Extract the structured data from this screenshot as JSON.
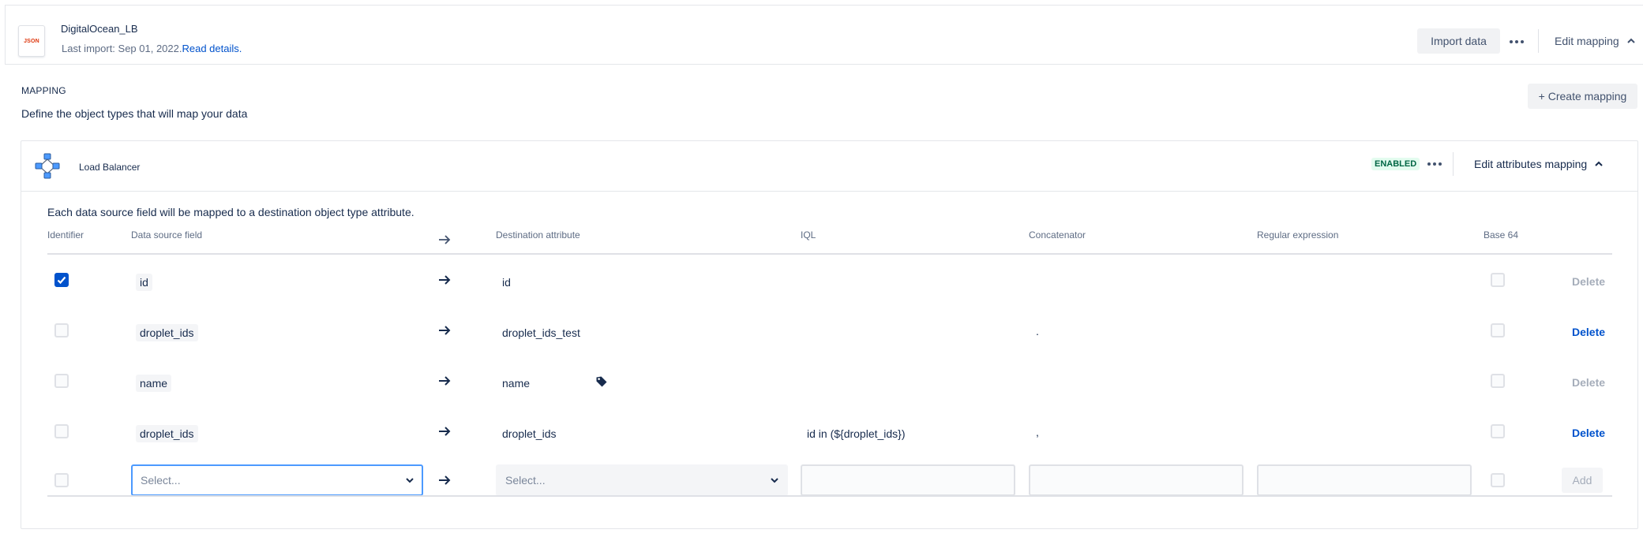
{
  "header": {
    "source_name": "DigitalOcean_LB",
    "file_badge": "JSON",
    "last_import_text": "Last import: Sep 01, 2022.",
    "read_details_link": "Read details.",
    "import_button": "Import data",
    "edit_mapping_button": "Edit mapping"
  },
  "mapping": {
    "section_title": "MAPPING",
    "section_description": "Define the object types that will map your data",
    "create_button": "+ Create mapping"
  },
  "object_mapping": {
    "title": "Load Balancer",
    "status": "ENABLED",
    "edit_attributes_button": "Edit attributes mapping",
    "intro": "Each data source field will be mapped to a destination object type attribute.",
    "columns": {
      "identifier": "Identifier",
      "source": "Data source field",
      "destination": "Destination attribute",
      "iql": "IQL",
      "concatenator": "Concatenator",
      "regex": "Regular expression",
      "base64": "Base 64"
    },
    "rows": [
      {
        "identifier": true,
        "source": "id",
        "destination": "id",
        "iql": "",
        "concatenator": "",
        "base64": false,
        "delete": "Delete",
        "delete_enabled": false
      },
      {
        "identifier": false,
        "source": "droplet_ids",
        "destination": "droplet_ids_test",
        "iql": "",
        "concatenator": ".",
        "base64": false,
        "delete": "Delete",
        "delete_enabled": true
      },
      {
        "identifier": false,
        "source": "name",
        "destination": "name",
        "iql": "",
        "concatenator": "",
        "base64": false,
        "delete": "Delete",
        "delete_enabled": false,
        "has_tag_icon": true
      },
      {
        "identifier": false,
        "source": "droplet_ids",
        "destination": "droplet_ids",
        "iql": "id in (${droplet_ids})",
        "concatenator": ",",
        "base64": false,
        "delete": "Delete",
        "delete_enabled": true
      }
    ],
    "new_row": {
      "source_placeholder": "Select...",
      "destination_placeholder": "Select...",
      "add_button": "Add"
    }
  },
  "colors": {
    "primary": "#0052cc",
    "focus_border": "#4c9aff",
    "enabled_bg": "#e3fcef",
    "enabled_text": "#006644",
    "json_badge": "#de350b"
  },
  "icons": [
    "json-file-icon",
    "more-dots-icon",
    "chevron-up-icon",
    "load-balancer-icon",
    "arrow-right-icon",
    "checkmark-icon",
    "chevron-down-icon",
    "tag-icon"
  ]
}
